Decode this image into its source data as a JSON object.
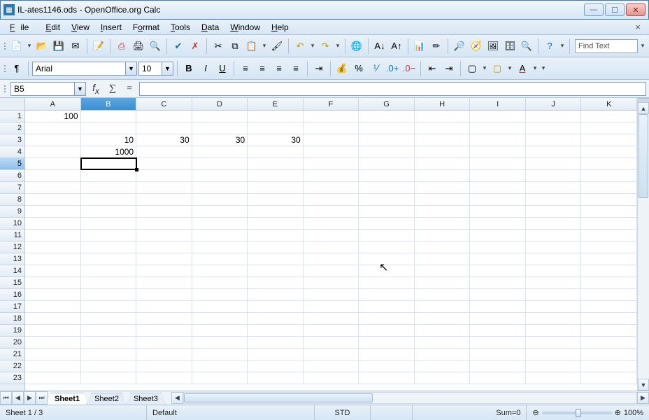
{
  "window": {
    "title": "IL-ates1146.ods - OpenOffice.org Calc"
  },
  "menu": {
    "file": "File",
    "edit": "Edit",
    "view": "View",
    "insert": "Insert",
    "format": "Format",
    "tools": "Tools",
    "data": "Data",
    "window": "Window",
    "help": "Help"
  },
  "toolbar": {
    "find_placeholder": "Find Text"
  },
  "format": {
    "font": "Arial",
    "size": "10"
  },
  "formula": {
    "cellref": "B5",
    "fx": "f",
    "sigma": "∑",
    "eq": "="
  },
  "columns": [
    "A",
    "B",
    "C",
    "D",
    "E",
    "F",
    "G",
    "H",
    "I",
    "J",
    "K"
  ],
  "rows_count": 23,
  "cells": {
    "A1": "100",
    "B3": "10",
    "C3": "30",
    "D3": "30",
    "E3": "30",
    "B4": "1000"
  },
  "selection": {
    "col": "B",
    "row": 5
  },
  "tabs": {
    "items": [
      "Sheet1",
      "Sheet2",
      "Sheet3"
    ],
    "active": 0
  },
  "status": {
    "sheet": "Sheet 1 / 3",
    "style": "Default",
    "insert": "STD",
    "sum": "Sum=0",
    "zoom": "100%"
  }
}
